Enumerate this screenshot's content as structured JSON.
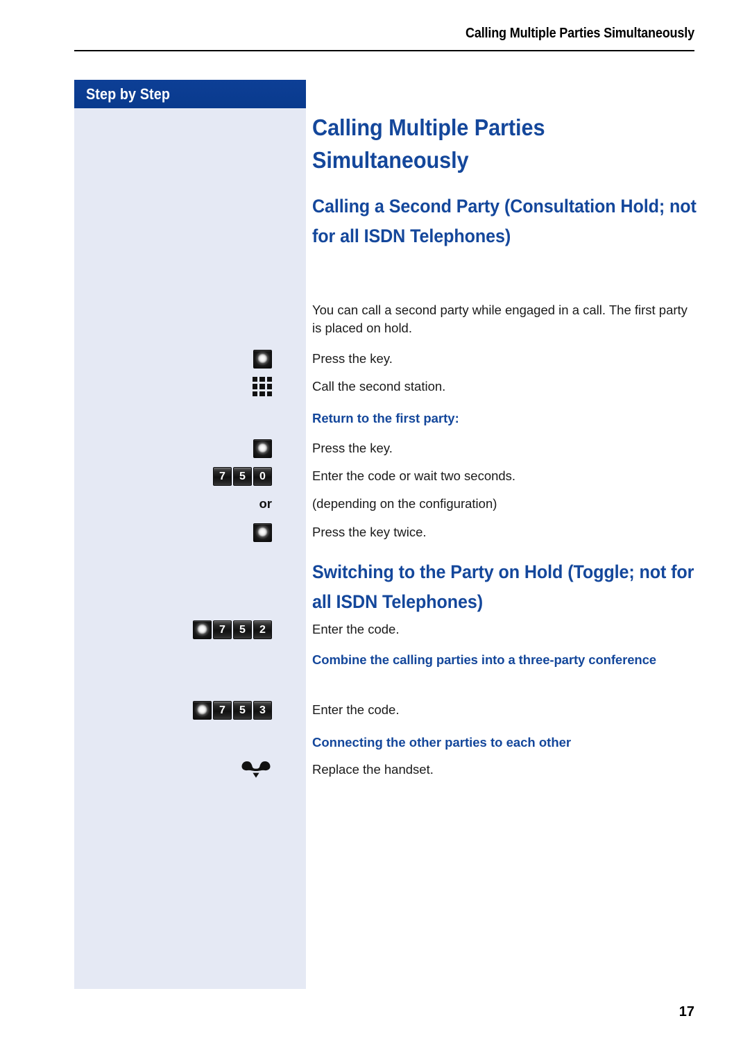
{
  "page": {
    "running_header": "Calling Multiple Parties Simultaneously",
    "page_number": "17",
    "accent_blue": "#14479b",
    "sidebar_bg": "#e5e9f4",
    "sidebar_header_bg": "#0b3c91"
  },
  "sidebar": {
    "header_label": "Step by Step"
  },
  "content": {
    "title": "Calling Multiple Parties Simultaneously",
    "section1": {
      "heading": "Calling a Second Party (Consultation Hold; not for all ISDN Telephones)",
      "intro": "You can call a second party while engaged in a call. The first party is placed on hold.",
      "steps": [
        {
          "icon": "round-key-icon",
          "text": "Press the key."
        },
        {
          "icon": "keypad-icon",
          "text": "Call the second station."
        }
      ],
      "subheading1": "Return to the first party:",
      "steps2": [
        {
          "icon": "round-key-icon",
          "text": "Press the key."
        },
        {
          "icon": "keycaps-750",
          "keys": [
            "7",
            "5",
            "0"
          ],
          "text": "Enter the code or wait two seconds."
        },
        {
          "icon": "or-marker",
          "marker": "or",
          "text": "(depending on the configuration)"
        },
        {
          "icon": "round-key-icon",
          "text": "Press the key twice."
        }
      ]
    },
    "section2": {
      "heading": "Switching to the Party on Hold (Toggle; not for all ISDN Telephones)",
      "step": {
        "icon": "keycaps-752",
        "keys": [
          "•",
          "7",
          "5",
          "2"
        ],
        "text": "Enter the code."
      },
      "subheading": "Combine the calling parties into a three-party conference",
      "step2": {
        "icon": "keycaps-753",
        "keys": [
          "•",
          "7",
          "5",
          "3"
        ],
        "text": "Enter the code."
      },
      "subheading2": "Connecting the other parties to each other",
      "step3": {
        "icon": "handset-icon",
        "text": "Replace the handset."
      }
    }
  }
}
